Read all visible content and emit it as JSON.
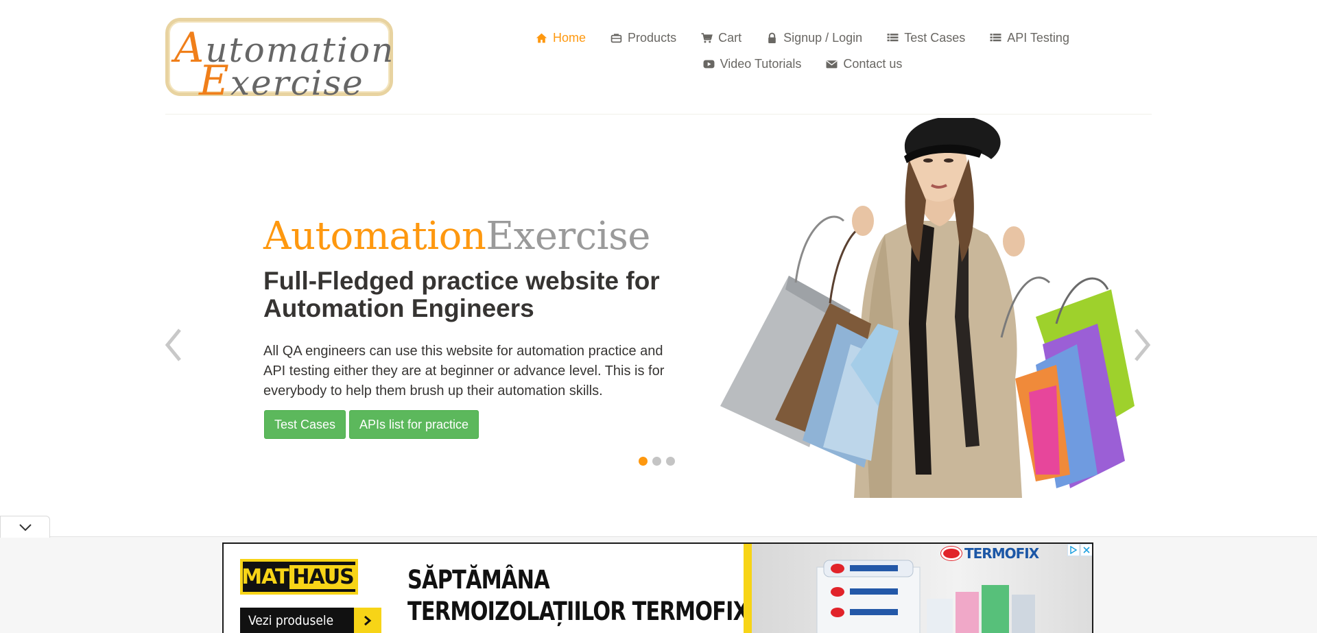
{
  "logo": {
    "line1": "Automation",
    "line2": "Exercise"
  },
  "nav": {
    "items": [
      {
        "label": "Home",
        "icon": "home-icon",
        "active": true
      },
      {
        "label": "Products",
        "icon": "briefcase-icon"
      },
      {
        "label": "Cart",
        "icon": "cart-icon"
      },
      {
        "label": "Signup / Login",
        "icon": "lock-icon"
      },
      {
        "label": "Test Cases",
        "icon": "list-icon"
      },
      {
        "label": "API Testing",
        "icon": "list-icon"
      },
      {
        "label": "Video Tutorials",
        "icon": "youtube-play-icon"
      },
      {
        "label": "Contact us",
        "icon": "envelope-icon"
      }
    ]
  },
  "slider": {
    "brand_part1": "Automation",
    "brand_part2": "Exercise",
    "headline": "Full-Fledged practice website for Automation Engineers",
    "description": "All QA engineers can use this website for automation practice and API testing either they are at beginner or advance level. This is for everybody to help them brush up their automation skills.",
    "button_test_cases": "Test Cases",
    "button_apis": "APIs list for practice",
    "slide_count": 3,
    "active_slide": 1
  },
  "ad": {
    "advertiser": "MATHAUS",
    "advertiser_part1": "MAT",
    "advertiser_part2": "HAUS",
    "cta": "Vezi produsele",
    "headline_line1": "SĂPTĂMÂNA",
    "headline_line2": "TERMOIZOLAȚIILOR TERMOFIX",
    "product_brand": "TERMOFIX"
  },
  "colors": {
    "accent": "#fe980f",
    "text": "#696763",
    "dark_text": "#363432",
    "button_green": "#5cb85c",
    "ad_yellow": "#f7d417"
  }
}
